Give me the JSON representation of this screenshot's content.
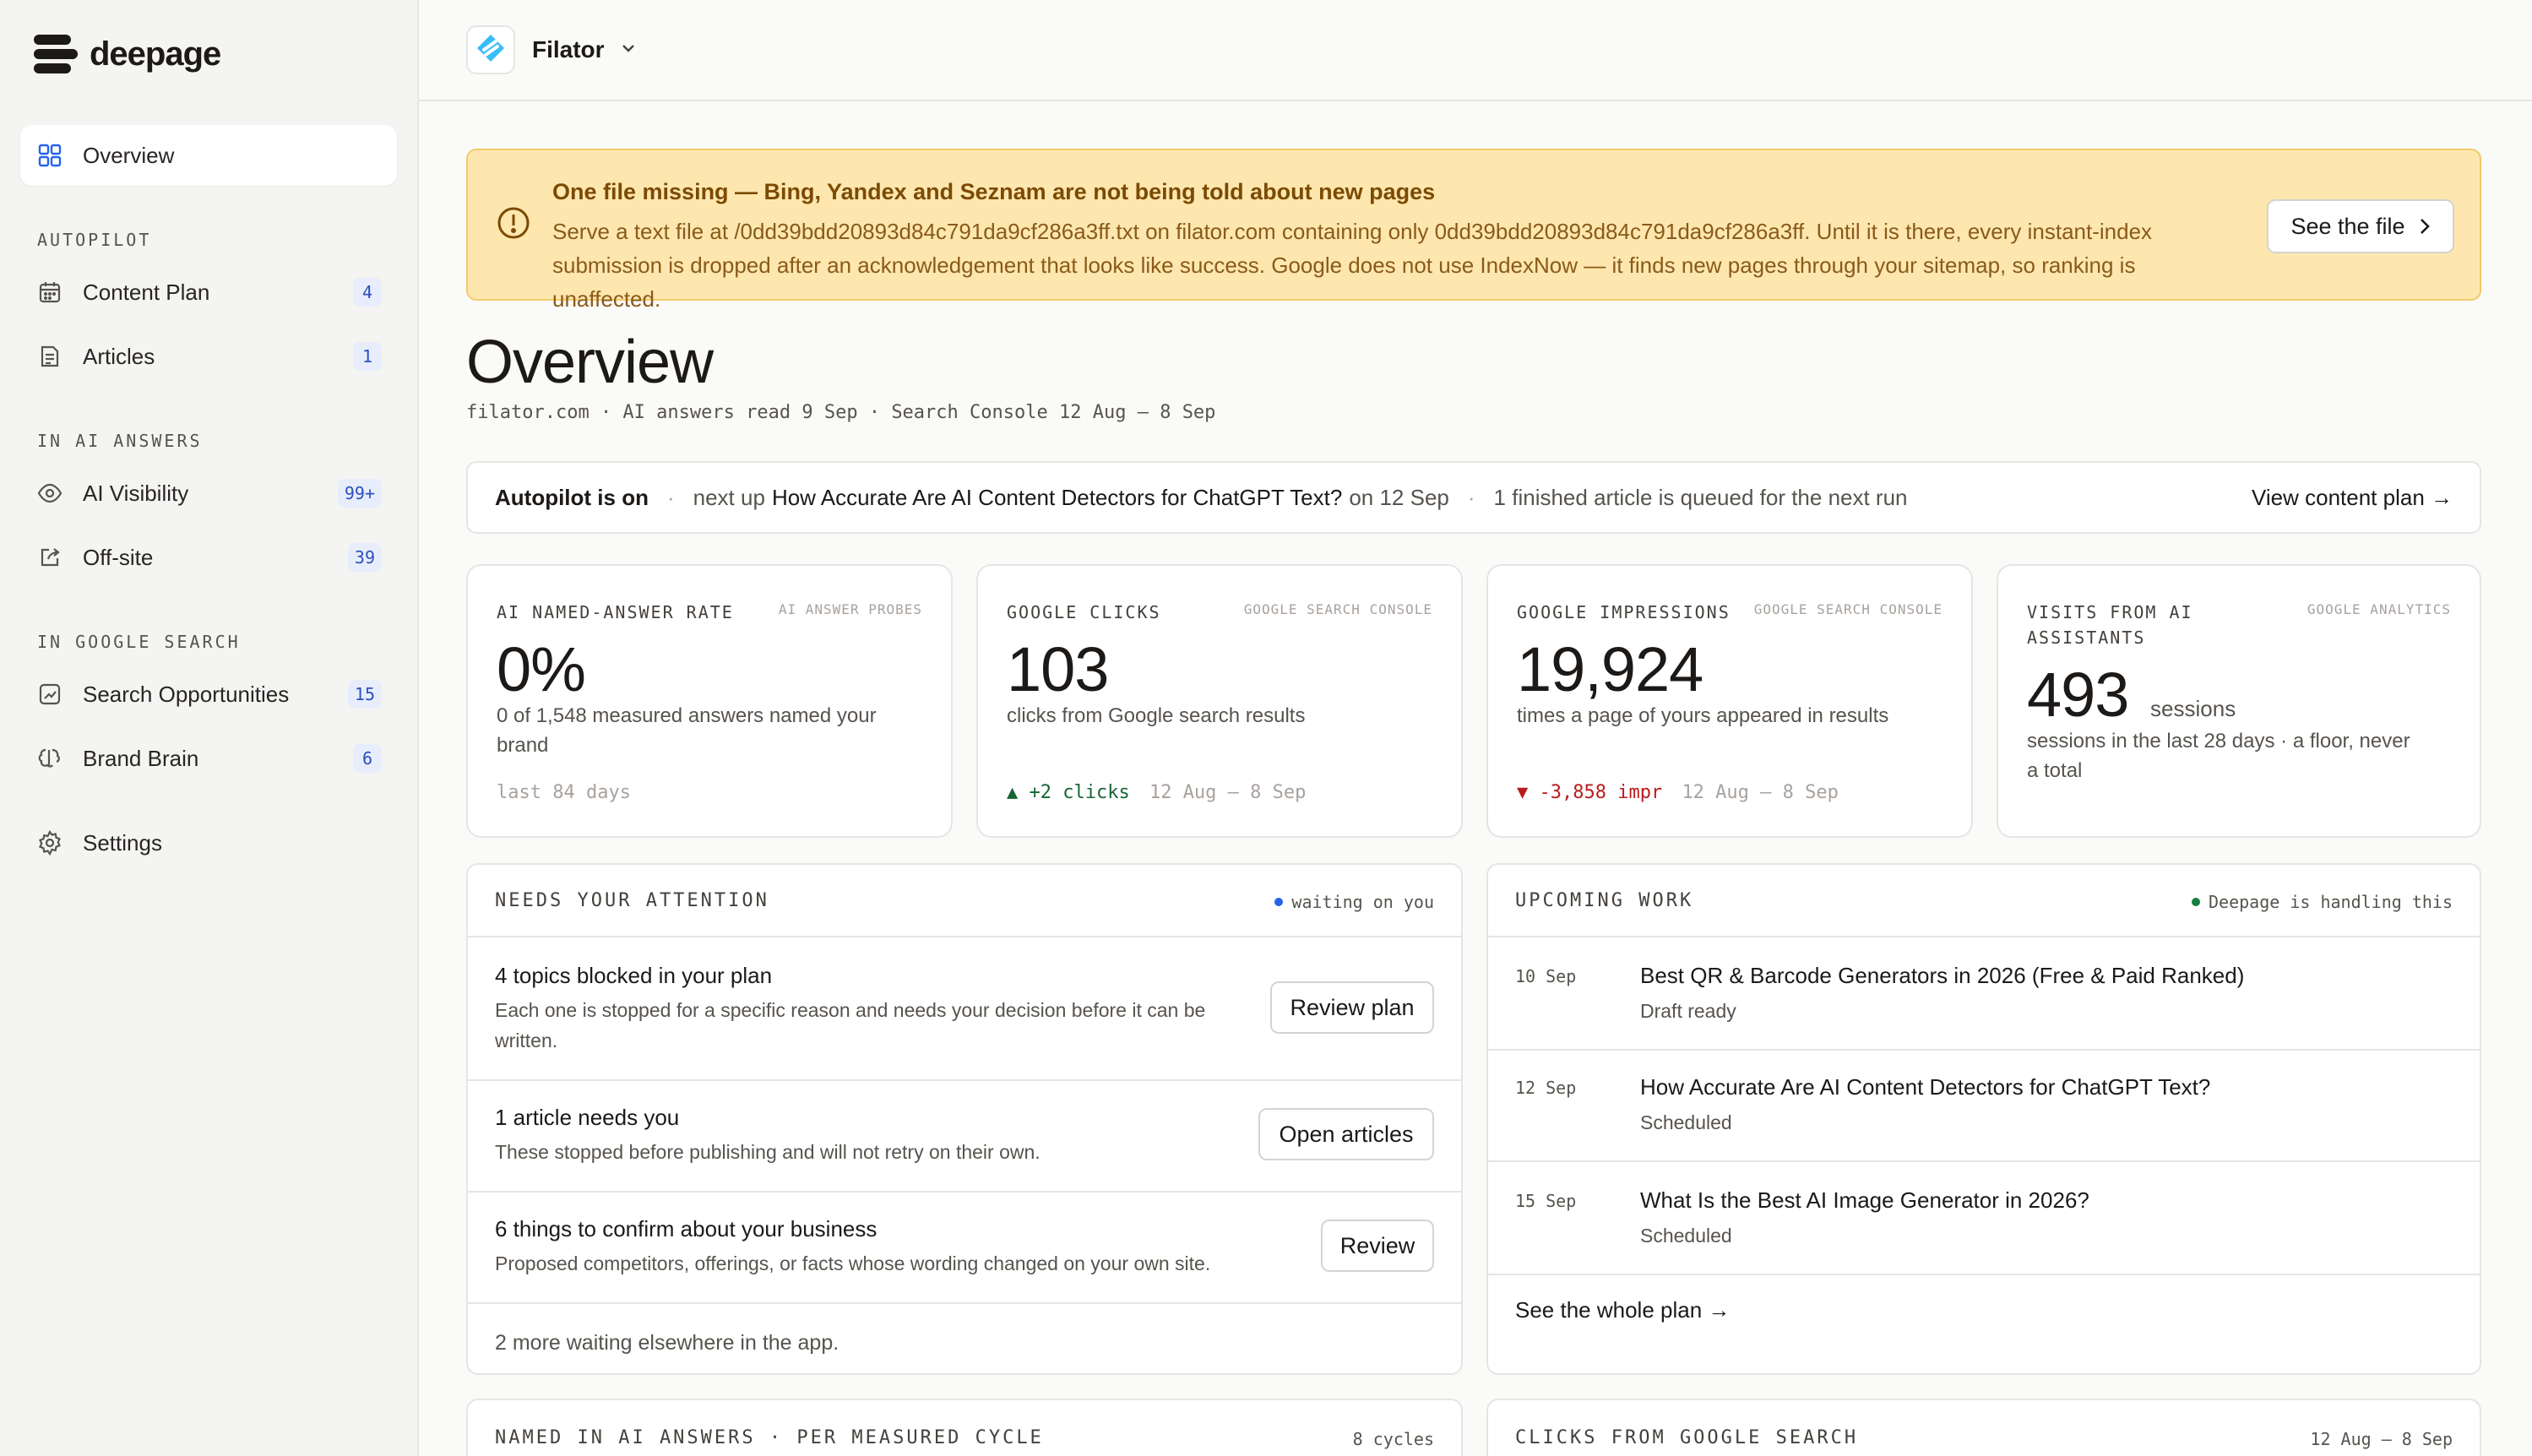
{
  "brand": {
    "name": "deepage"
  },
  "sidebar": {
    "overview": "Overview",
    "sections": [
      {
        "title": "AUTOPILOT",
        "items": [
          {
            "label": "Content Plan",
            "badge": "4"
          },
          {
            "label": "Articles",
            "badge": "1"
          }
        ]
      },
      {
        "title": "IN AI ANSWERS",
        "items": [
          {
            "label": "AI Visibility",
            "badge": "99+"
          },
          {
            "label": "Off-site",
            "badge": "39"
          }
        ]
      },
      {
        "title": "IN GOOGLE SEARCH",
        "items": [
          {
            "label": "Search Opportunities",
            "badge": "15"
          },
          {
            "label": "Brand Brain",
            "badge": "6"
          }
        ]
      }
    ],
    "settings": "Settings"
  },
  "topbar": {
    "site_name": "Filator"
  },
  "alert": {
    "title": "One file missing — Bing, Yandex and Seznam are not being told about new pages",
    "body": "Serve a text file at /0dd39bdd20893d84c791da9cf286a3ff.txt on filator.com containing only 0dd39bdd20893d84c791da9cf286a3ff. Until it is there, every instant-index submission is dropped after an acknowledgement that looks like success. Google does not use IndexNow — it finds new pages through your sitemap, so ranking is unaffected.",
    "button": "See the file"
  },
  "page": {
    "title": "Overview",
    "subline": "filator.com · AI answers read 9 Sep · Search Console 12 Aug – 8 Sep"
  },
  "autopilot": {
    "status": "Autopilot is on",
    "next_prefix": "next up",
    "next_title": "How Accurate Are AI Content Detectors for ChatGPT Text?",
    "next_date": "on 12 Sep",
    "queued": "1 finished article is queued for the next run",
    "link": "View content plan →"
  },
  "stats": [
    {
      "label": "AI NAMED-ANSWER RATE",
      "source": "AI ANSWER PROBES",
      "value": "0%",
      "desc": "0 of 1,548 measured answers named your brand",
      "foot": "last 84 days"
    },
    {
      "label": "GOOGLE CLICKS",
      "source": "GOOGLE SEARCH CONSOLE",
      "value": "103",
      "desc": "clicks from Google search results",
      "delta": "▲ +2 clicks",
      "foot": "12 Aug – 8 Sep"
    },
    {
      "label": "GOOGLE IMPRESSIONS",
      "source": "GOOGLE SEARCH CONSOLE",
      "value": "19,924",
      "desc": "times a page of yours appeared in results",
      "delta": "▼ -3,858 impr",
      "foot": "12 Aug – 8 Sep"
    },
    {
      "label": "VISITS FROM AI ASSISTANTS",
      "source": "GOOGLE ANALYTICS",
      "value": "493",
      "unit": "sessions",
      "desc": "sessions in the last 28 days · a floor, never a total"
    }
  ],
  "attention": {
    "title": "NEEDS YOUR ATTENTION",
    "status": "waiting on you",
    "status_color": "#2563eb",
    "items": [
      {
        "title": "4 topics blocked in your plan",
        "sub": "Each one is stopped for a specific reason and needs your decision before it can be written.",
        "button": "Review plan"
      },
      {
        "title": "1 article needs you",
        "sub": "These stopped before publishing and will not retry on their own.",
        "button": "Open articles"
      },
      {
        "title": "6 things to confirm about your business",
        "sub": "Proposed competitors, offerings, or facts whose wording changed on your own site.",
        "button": "Review"
      }
    ],
    "footer": "2 more waiting elsewhere in the app."
  },
  "upcoming": {
    "title": "UPCOMING WORK",
    "status": "Deepage is handling this",
    "status_color": "#15803d",
    "items": [
      {
        "date": "10 Sep",
        "title": "Best QR & Barcode Generators in 2026 (Free & Paid Ranked)",
        "status": "Draft ready"
      },
      {
        "date": "12 Sep",
        "title": "How Accurate Are AI Content Detectors for ChatGPT Text?",
        "status": "Scheduled"
      },
      {
        "date": "15 Sep",
        "title": "What Is the Best AI Image Generator in 2026?",
        "status": "Scheduled"
      }
    ],
    "footer": "See the whole plan →"
  },
  "bottom": {
    "left_title": "NAMED IN AI ANSWERS · PER MEASURED CYCLE",
    "left_meta": "8 cycles",
    "right_title": "CLICKS FROM GOOGLE SEARCH",
    "right_meta": "12 Aug – 8 Sep"
  }
}
